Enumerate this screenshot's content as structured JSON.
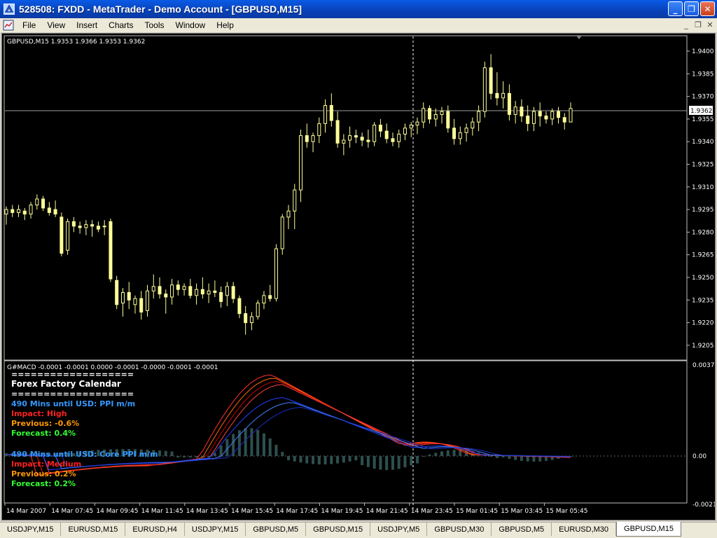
{
  "window": {
    "title": "528508: FXDD - MetaTrader - Demo Account - [GBPUSD,M15]",
    "minimize_glyph": "_",
    "maximize_glyph": "❐",
    "close_glyph": "✕"
  },
  "menu": {
    "items": [
      "File",
      "View",
      "Insert",
      "Charts",
      "Tools",
      "Window",
      "Help"
    ],
    "mdi_minimize_glyph": "_",
    "mdi_restore_glyph": "❐",
    "mdi_close_glyph": "✕"
  },
  "main_chart": {
    "header": "GBPUSD,M15  1.9353 1.9366 1.9353 1.9362",
    "current_price_label": "1.9362",
    "price_ticks": [
      "1.9400",
      "1.9385",
      "1.9370",
      "1.9355",
      "1.9340",
      "1.9325",
      "1.9310",
      "1.9295",
      "1.9280",
      "1.9265",
      "1.9250",
      "1.9235",
      "1.9220",
      "1.9205"
    ],
    "candle_color": "#ffff99",
    "background_color": "#000000"
  },
  "indicator": {
    "header": "G#MACD -0.0001 -0.0001 0.0000 -0.0001 -0.0000 -0.0001 -0.0001",
    "ticks": [
      "0.0037",
      "0.00",
      "-0.0021"
    ],
    "histogram_color": "#2f4f4f"
  },
  "calendar": {
    "separator_top": "===================",
    "title": "Forex Factory Calendar",
    "separator_bottom": "===================",
    "event1": {
      "headline": "490 Mins until USD: PPI m/m",
      "impact": "Impact: High",
      "previous": "Previous: -0.6%",
      "forecast": "Forecast: 0.4%"
    },
    "event2": {
      "headline": "490 Mins until USD: Core PPI m/m",
      "impact": "Impact: Medium",
      "previous": "Previous: 0.2%",
      "forecast": "Forecast: 0.2%"
    },
    "colors": {
      "headline": "#3399ff",
      "impact": "#ff2020",
      "previous": "#ff9900",
      "forecast": "#33ff33"
    }
  },
  "time_axis": [
    "14 Mar 2007",
    "14 Mar 07:45",
    "14 Mar 09:45",
    "14 Mar 11:45",
    "14 Mar 13:45",
    "14 Mar 15:45",
    "14 Mar 17:45",
    "14 Mar 19:45",
    "14 Mar 21:45",
    "14 Mar 23:45",
    "15 Mar 01:45",
    "15 Mar 03:45",
    "15 Mar 05:45"
  ],
  "tabs": [
    "USDJPY,M15",
    "EURUSD,M15",
    "EURUSD,H4",
    "USDJPY,M15",
    "GBPUSD,M5",
    "GBPUSD,M15",
    "USDJPY,M5",
    "GBPUSD,M30",
    "GBPUSD,M5",
    "EURUSD,M30",
    "GBPUSD,M15"
  ],
  "active_tab_index": 10,
  "chart_data": {
    "type": "candlestick",
    "symbol": "GBPUSD",
    "timeframe": "M15",
    "ylim": [
      1.92,
      1.941
    ],
    "candles": [
      [
        1.9292,
        1.9297,
        1.9285,
        1.9295
      ],
      [
        1.9295,
        1.9298,
        1.929,
        1.9293
      ],
      [
        1.9293,
        1.9298,
        1.929,
        1.9295
      ],
      [
        1.9294,
        1.9296,
        1.9288,
        1.9292
      ],
      [
        1.9292,
        1.93,
        1.9289,
        1.9298
      ],
      [
        1.9298,
        1.9305,
        1.9295,
        1.9302
      ],
      [
        1.9302,
        1.9304,
        1.9294,
        1.9296
      ],
      [
        1.9296,
        1.93,
        1.9291,
        1.9293
      ],
      [
        1.9295,
        1.9301,
        1.929,
        1.9292
      ],
      [
        1.929,
        1.9293,
        1.9264,
        1.9266
      ],
      [
        1.9268,
        1.9289,
        1.9265,
        1.9287
      ],
      [
        1.9287,
        1.929,
        1.928,
        1.9284
      ],
      [
        1.9284,
        1.9287,
        1.9279,
        1.9283
      ],
      [
        1.9283,
        1.9288,
        1.9278,
        1.9285
      ],
      [
        1.9285,
        1.9288,
        1.9277,
        1.9284
      ],
      [
        1.9284,
        1.9287,
        1.928,
        1.9282
      ],
      [
        1.9284,
        1.9288,
        1.9278,
        1.9284
      ],
      [
        1.9287,
        1.9289,
        1.9247,
        1.9249
      ],
      [
        1.9248,
        1.9251,
        1.9229,
        1.9232
      ],
      [
        1.9233,
        1.9243,
        1.9224,
        1.924
      ],
      [
        1.924,
        1.9247,
        1.9229,
        1.9235
      ],
      [
        1.9232,
        1.9238,
        1.9226,
        1.9236
      ],
      [
        1.9236,
        1.9241,
        1.9222,
        1.9227
      ],
      [
        1.9228,
        1.9245,
        1.9224,
        1.9241
      ],
      [
        1.9241,
        1.9252,
        1.9236,
        1.9244
      ],
      [
        1.9244,
        1.925,
        1.9236,
        1.9239
      ],
      [
        1.9239,
        1.9242,
        1.9226,
        1.9237
      ],
      [
        1.9237,
        1.9249,
        1.9232,
        1.9245
      ],
      [
        1.9245,
        1.9248,
        1.9238,
        1.9242
      ],
      [
        1.9242,
        1.9246,
        1.9238,
        1.9244
      ],
      [
        1.9244,
        1.9249,
        1.9236,
        1.9238
      ],
      [
        1.9238,
        1.9246,
        1.9232,
        1.9242
      ],
      [
        1.9242,
        1.925,
        1.9236,
        1.9239
      ],
      [
        1.9239,
        1.9246,
        1.9233,
        1.9241
      ],
      [
        1.9241,
        1.9248,
        1.9237,
        1.924
      ],
      [
        1.924,
        1.9244,
        1.923,
        1.9234
      ],
      [
        1.9238,
        1.9247,
        1.9231,
        1.9244
      ],
      [
        1.9244,
        1.9247,
        1.9233,
        1.9236
      ],
      [
        1.9236,
        1.9238,
        1.9223,
        1.9226
      ],
      [
        1.9226,
        1.9231,
        1.9212,
        1.922
      ],
      [
        1.922,
        1.9227,
        1.9215,
        1.9224
      ],
      [
        1.9224,
        1.9235,
        1.9222,
        1.9233
      ],
      [
        1.9233,
        1.9241,
        1.9229,
        1.9238
      ],
      [
        1.9238,
        1.9245,
        1.9234,
        1.9236
      ],
      [
        1.9236,
        1.9272,
        1.9234,
        1.9269
      ],
      [
        1.9269,
        1.9292,
        1.9265,
        1.929
      ],
      [
        1.929,
        1.9298,
        1.9282,
        1.9294
      ],
      [
        1.9294,
        1.9312,
        1.9282,
        1.9308
      ],
      [
        1.9308,
        1.9348,
        1.93,
        1.9344
      ],
      [
        1.9344,
        1.9352,
        1.9336,
        1.934
      ],
      [
        1.934,
        1.9346,
        1.9333,
        1.9344
      ],
      [
        1.9344,
        1.9356,
        1.9339,
        1.9352
      ],
      [
        1.9352,
        1.9368,
        1.9346,
        1.9364
      ],
      [
        1.9364,
        1.9372,
        1.935,
        1.9354
      ],
      [
        1.9354,
        1.936,
        1.9336,
        1.9339
      ],
      [
        1.9339,
        1.9345,
        1.9331,
        1.9341
      ],
      [
        1.9341,
        1.935,
        1.9336,
        1.9344
      ],
      [
        1.9344,
        1.9348,
        1.9339,
        1.9343
      ],
      [
        1.9343,
        1.9346,
        1.9337,
        1.9341
      ],
      [
        1.9341,
        1.9348,
        1.9336,
        1.934
      ],
      [
        1.934,
        1.9353,
        1.9337,
        1.9351
      ],
      [
        1.9351,
        1.9355,
        1.9343,
        1.9347
      ],
      [
        1.9347,
        1.9352,
        1.9339,
        1.9342
      ],
      [
        1.9342,
        1.9346,
        1.9337,
        1.934
      ],
      [
        1.934,
        1.9348,
        1.9336,
        1.9345
      ],
      [
        1.9345,
        1.9352,
        1.9341,
        1.9349
      ],
      [
        1.9349,
        1.9353,
        1.9343,
        1.9351
      ],
      [
        1.9351,
        1.9356,
        1.9345,
        1.9353
      ],
      [
        1.9353,
        1.9366,
        1.9349,
        1.9362
      ],
      [
        1.9362,
        1.9364,
        1.9352,
        1.9355
      ],
      [
        1.9355,
        1.9362,
        1.935,
        1.9358
      ],
      [
        1.9358,
        1.9363,
        1.9352,
        1.936
      ],
      [
        1.936,
        1.9364,
        1.9346,
        1.9349
      ],
      [
        1.9349,
        1.9355,
        1.9338,
        1.9342
      ],
      [
        1.9342,
        1.935,
        1.9338,
        1.9346
      ],
      [
        1.9346,
        1.9352,
        1.934,
        1.9349
      ],
      [
        1.9349,
        1.9356,
        1.9344,
        1.9353
      ],
      [
        1.9353,
        1.9364,
        1.9347,
        1.936
      ],
      [
        1.936,
        1.9393,
        1.9356,
        1.9389
      ],
      [
        1.9389,
        1.9398,
        1.9368,
        1.9372
      ],
      [
        1.9372,
        1.9386,
        1.9364,
        1.9369
      ],
      [
        1.9369,
        1.938,
        1.9362,
        1.9372
      ],
      [
        1.9372,
        1.9378,
        1.9354,
        1.9358
      ],
      [
        1.9358,
        1.9367,
        1.9352,
        1.9363
      ],
      [
        1.9363,
        1.9368,
        1.9353,
        1.9357
      ],
      [
        1.9357,
        1.9364,
        1.9347,
        1.9352
      ],
      [
        1.9352,
        1.9363,
        1.9347,
        1.936
      ],
      [
        1.936,
        1.9366,
        1.935,
        1.9357
      ],
      [
        1.9357,
        1.936,
        1.9352,
        1.9355
      ],
      [
        1.9355,
        1.9362,
        1.9351,
        1.936
      ],
      [
        1.936,
        1.9363,
        1.9352,
        1.9356
      ],
      [
        1.9356,
        1.9359,
        1.9348,
        1.9353
      ],
      [
        1.9353,
        1.9366,
        1.9353,
        1.9362
      ]
    ]
  }
}
